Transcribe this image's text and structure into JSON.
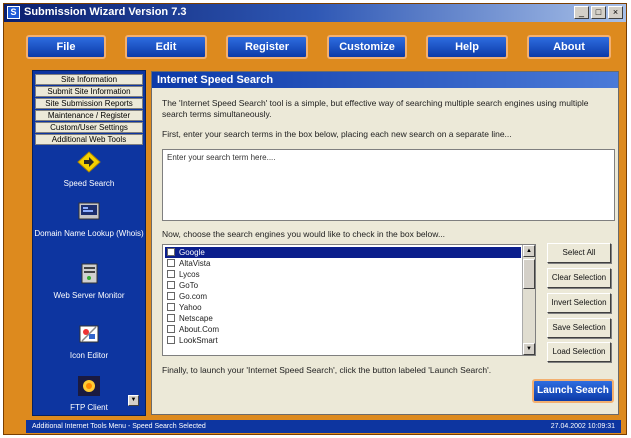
{
  "window": {
    "title": "Submission Wizard Version 7.3",
    "app_icon": "S",
    "buttons": [
      "_",
      "□",
      "×"
    ]
  },
  "menu": [
    "File",
    "Edit",
    "Register",
    "Customize",
    "Help",
    "About"
  ],
  "sidebar": {
    "tabs": [
      "Site Information",
      "Submit Site Information",
      "Site Submission Reports",
      "Maintenance / Register",
      "Custom/User Settings",
      "Additional Web Tools"
    ],
    "tools": [
      {
        "label": "Speed Search",
        "icon": "arrow-icon"
      },
      {
        "label": "Domain Name Lookup (Whois)",
        "icon": "lookup-icon"
      },
      {
        "label": "Web Server Monitor",
        "icon": "monitor-icon"
      },
      {
        "label": "Icon Editor",
        "icon": "icon-editor-icon"
      },
      {
        "label": "FTP Client",
        "icon": "ftp-icon"
      }
    ]
  },
  "main": {
    "header": "Internet Speed Search",
    "description": "The 'Internet Speed Search' tool is a simple, but effective way of searching multiple search engines using multiple search terms simultaneously.",
    "step1": "First, enter your search terms in the box below, placing each new search on a separate line...",
    "search_placeholder": "Enter your search term here....",
    "step2": "Now, choose the search engines you would like to check in the box below...",
    "engines": [
      "Google",
      "AltaVista",
      "Lycos",
      "GoTo",
      "Go.com",
      "Yahoo",
      "Netscape",
      "About.Com",
      "LookSmart"
    ],
    "selected_engine": "Google",
    "buttons": {
      "select_all": "Select All",
      "clear_selection": "Clear Selection",
      "invert_selection": "Invert Selection",
      "save_selection": "Save Selection",
      "load_selection": "Load Selection"
    },
    "step3": "Finally, to launch your 'Internet Speed Search', click the button labeled 'Launch Search'.",
    "launch": "Launch Search"
  },
  "status": {
    "left": "Additional Internet Tools Menu - Speed Search Selected",
    "right": "27.04.2002 10:09:31"
  },
  "colors": {
    "frame": "#dd8a1e",
    "accent_blue": "#0d35a0",
    "selection": "#0a1e8c"
  }
}
